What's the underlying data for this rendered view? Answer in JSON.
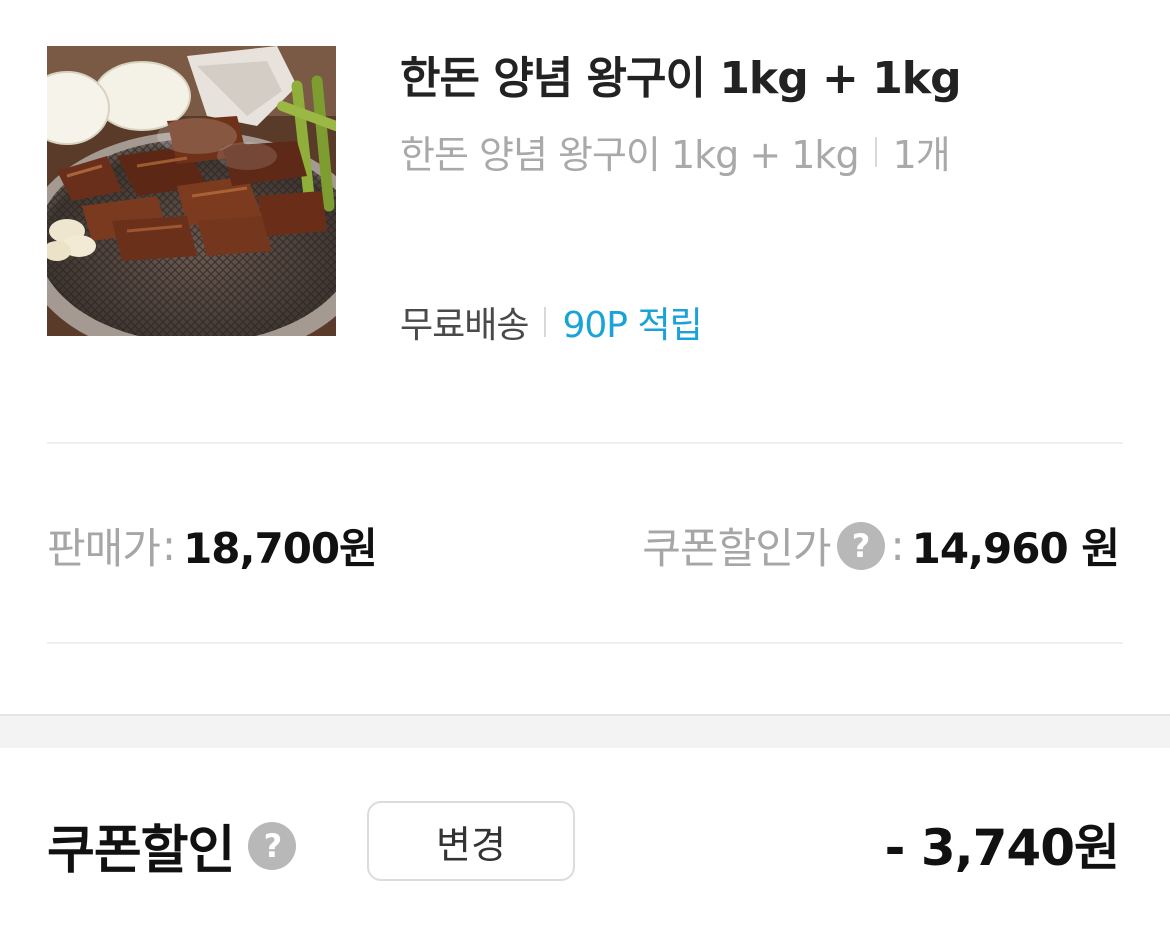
{
  "product": {
    "name": "한돈 양념 왕구이 1kg + 1kg",
    "option_name": "한돈 양념 왕구이 1kg + 1kg",
    "quantity": "1개",
    "shipping": "무료배송",
    "points": "90P 적립"
  },
  "prices": {
    "sale_label": "판매가",
    "sale_value": "18,700원",
    "coupon_label": "쿠폰할인가",
    "coupon_value": "14,960 원",
    "colon": ":"
  },
  "coupon": {
    "title": "쿠폰할인",
    "change_label": "변경",
    "discount": "- 3,740원"
  },
  "icons": {
    "help": "?"
  },
  "colors": {
    "points_accent": "#1aa3d8",
    "muted_text": "#a6a6a6",
    "help_badge": "#b8b8b8"
  }
}
